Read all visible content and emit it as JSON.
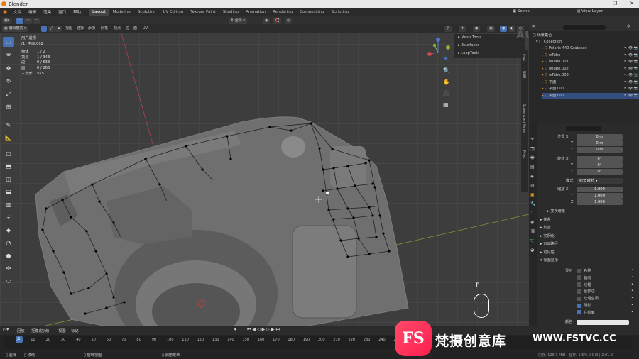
{
  "app": {
    "title": "Blender"
  },
  "window_controls": {
    "minimize": "—",
    "maximize": "❐",
    "close": "✕"
  },
  "menu": [
    "文件",
    "编辑",
    "渲染",
    "窗口",
    "帮助"
  ],
  "workspaces": [
    "Layout",
    "Modeling",
    "Sculpting",
    "UV Editing",
    "Texture Paint",
    "Shading",
    "Animation",
    "Rendering",
    "Compositing",
    "Scripting"
  ],
  "active_workspace": "Layout",
  "scene": {
    "label": "Scene",
    "view_layer": "View Layer"
  },
  "viewport_header": {
    "mode": "编辑模式",
    "menus": [
      "视图",
      "选择",
      "添加",
      "网格",
      "顶点",
      "边",
      "面",
      "UV"
    ],
    "transform_orientation": "全局"
  },
  "viewport_info": {
    "view": "用户透视",
    "object": "(1) 平面.002",
    "stats": [
      {
        "label": "物体",
        "value": "1 / 2"
      },
      {
        "label": "顶点",
        "value": "1 / 348"
      },
      {
        "label": "边",
        "value": "0 / 638"
      },
      {
        "label": "面",
        "value": "0 / 266"
      },
      {
        "label": "三角形",
        "value": "555"
      }
    ]
  },
  "addons_panel": [
    "Mesh Tools",
    "Bsurfaces",
    "LoopTools"
  ],
  "key_overlay": "F",
  "side_tabs": [
    "工具",
    "视图",
    "Screencast Keys",
    "Misc"
  ],
  "outliner": {
    "title": "场景集合",
    "root": "Collection",
    "items": [
      {
        "name": "Polaris 440 Gratscad",
        "selected": false
      },
      {
        "name": "wTube",
        "selected": false
      },
      {
        "name": "wTube.001",
        "selected": false
      },
      {
        "name": "wTube.002",
        "selected": false
      },
      {
        "name": "wTube.003",
        "selected": false
      },
      {
        "name": "平面",
        "selected": false
      },
      {
        "name": "平面.001",
        "selected": false
      },
      {
        "name": "平面.002",
        "selected": true
      }
    ]
  },
  "properties": {
    "location": {
      "label": "位置 X",
      "x": "0 m",
      "y": "0 m",
      "z": "0 m"
    },
    "rotation": {
      "label": "旋转 X",
      "x": "0°",
      "y": "0°",
      "z": "0°"
    },
    "mode": {
      "label": "模式",
      "value": "XYZ 欧拉"
    },
    "scale": {
      "label": "缩放 X",
      "x": "1.000",
      "y": "1.000",
      "z": "1.000"
    },
    "axis_labels": {
      "y": "Y",
      "z": "Z"
    },
    "sections": [
      "变换增量",
      "关系",
      "集合",
      "实例化",
      "运动路径",
      "可见性",
      "视图显示"
    ],
    "display": {
      "label": "显示",
      "options": [
        {
          "label": "名称",
          "checked": false
        },
        {
          "label": "轴向",
          "checked": false
        },
        {
          "label": "线框",
          "checked": false
        },
        {
          "label": "全部边",
          "checked": false
        },
        {
          "label": "纹理空间",
          "checked": false
        },
        {
          "label": "阴影",
          "checked": true
        },
        {
          "label": "在前面",
          "checked": true
        }
      ],
      "color_label": "颜色"
    }
  },
  "timeline": {
    "menus": [
      "回放",
      "抠像(插帧)",
      "视图",
      "标记"
    ],
    "ticks": [
      "0",
      "10",
      "20",
      "30",
      "40",
      "50",
      "60",
      "70",
      "80",
      "90",
      "100",
      "110",
      "120",
      "130",
      "140",
      "150",
      "160",
      "170",
      "180",
      "190",
      "200",
      "210",
      "220",
      "230",
      "240",
      "250"
    ],
    "current_frame": "1"
  },
  "statusbar": {
    "items": [
      "选择",
      "移动",
      "旋转视图",
      "调用菜单"
    ],
    "right": "内存: 126.3 MiB | 显存: 1.5/6.0 GiB | 2.91.0"
  },
  "watermark": {
    "logo": "FS",
    "text": "梵摄创意库",
    "url": "WWW.FSTVC.CC",
    "faint": "AUTOCORP"
  },
  "colors": {
    "accent": "#4772b3",
    "selected_row": "#334d80",
    "mesh": "#6e6e6e",
    "vertex": "#000000",
    "x_axis": "#c8484d",
    "y_axis": "#8bb03a"
  }
}
